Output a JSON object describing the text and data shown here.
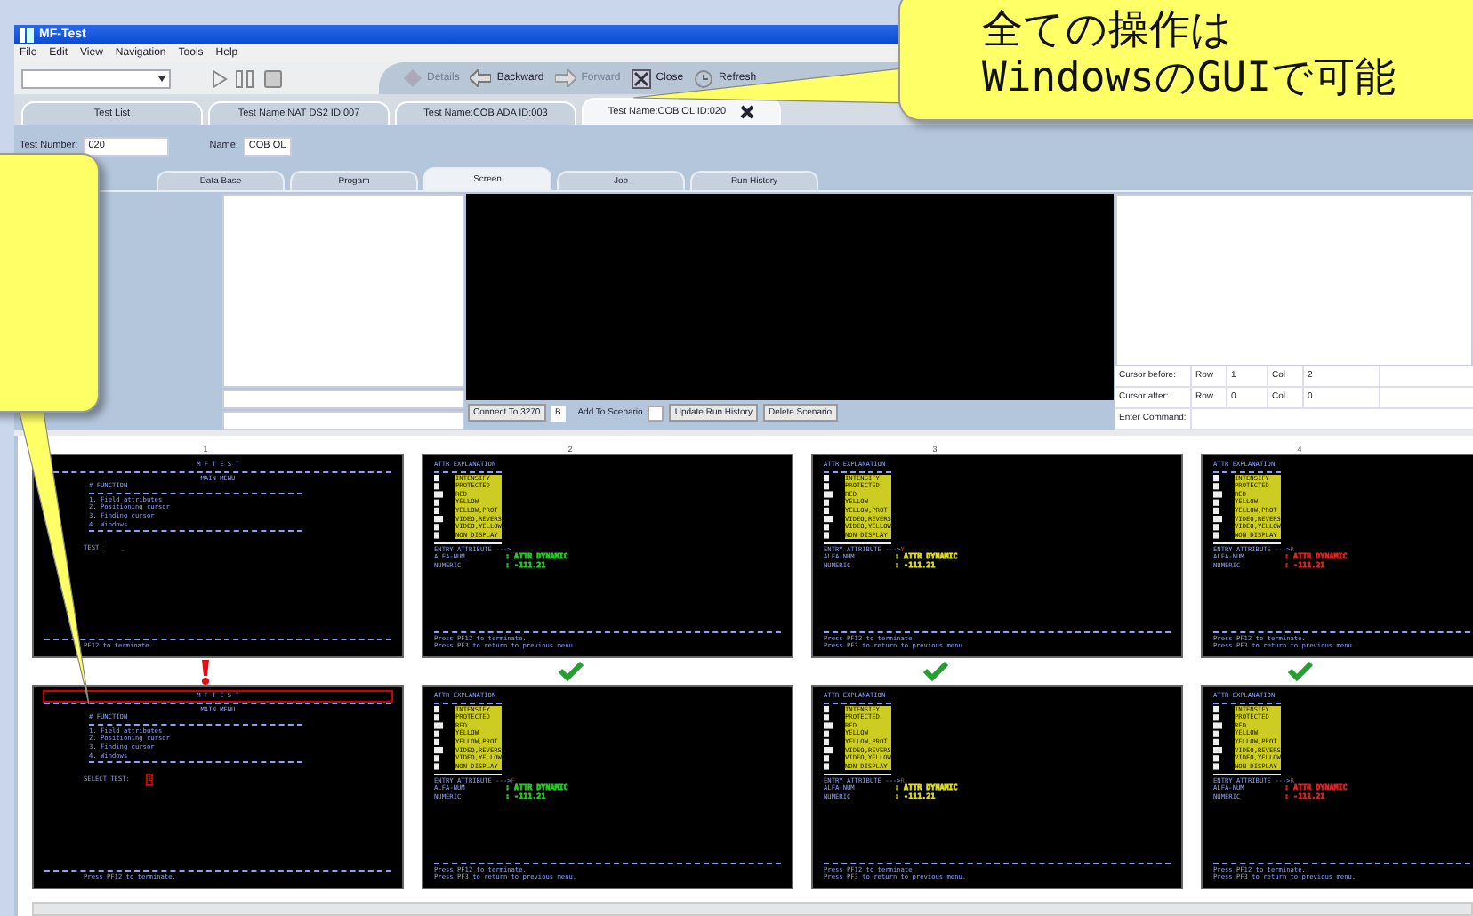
{
  "window": {
    "title": "MF-Test"
  },
  "menu": [
    "File",
    "Edit",
    "View",
    "Navigation",
    "Tools",
    "Help"
  ],
  "toolbar": [
    {
      "label": "Details",
      "kind": "details",
      "disabled": true
    },
    {
      "label": "Backward",
      "kind": "back",
      "disabled": false
    },
    {
      "label": "Forward",
      "kind": "forward",
      "disabled": true
    },
    {
      "label": "Close",
      "kind": "close",
      "disabled": false
    },
    {
      "label": "Refresh",
      "kind": "refresh",
      "disabled": false
    }
  ],
  "doc_tabs": [
    {
      "label": "Test List",
      "selected": false
    },
    {
      "label": "Test Name:NAT DS2  ID:007",
      "selected": false
    },
    {
      "label": "Test Name:COB ADA  ID:003",
      "selected": false
    },
    {
      "label": "Test Name:COB OL  ID:020",
      "selected": true
    }
  ],
  "form": {
    "number_label": "Test Number:",
    "number": "020",
    "name_label": "Name:",
    "name": "COB OL"
  },
  "inner_tabs": [
    {
      "label": "Data Base",
      "selected": false
    },
    {
      "label": "Progam",
      "selected": false
    },
    {
      "label": "Screen",
      "selected": true
    },
    {
      "label": "Job",
      "selected": false
    },
    {
      "label": "Run History",
      "selected": false
    }
  ],
  "screen_panel": {
    "connect": "Connect To 3270",
    "session": "B",
    "add_label": "Add To Scenario",
    "add_checked": false,
    "buttons": [
      "Update Run History",
      "Delete Scenario"
    ]
  },
  "cursor": {
    "rows": [
      {
        "label": "Cursor before:",
        "row_label": "Row",
        "row": "1",
        "col_label": "Col",
        "col": "2"
      },
      {
        "label": "Cursor after:",
        "row_label": "Row",
        "row": "0",
        "col_label": "Col",
        "col": "0"
      }
    ],
    "command_label": "Enter Command:"
  },
  "comparison": {
    "columns": [
      "1",
      "2",
      "3",
      "4"
    ],
    "rows": [
      {
        "screens": [
          {
            "kind": "menu",
            "title": "M F T E S T",
            "subtitle": "MAIN MENU",
            "header": "# FUNCTION",
            "items": [
              "1. Field attributes",
              "2. Positioning cursor",
              "3. Finding cursor",
              "4. Windows"
            ],
            "prompt": "TEST:",
            "entry": "_",
            "marked": false,
            "footer": [
              "PF12 to terminate."
            ]
          },
          {
            "kind": "attr",
            "title": "ATTR EXPLANATION",
            "attributes": [
              "INTENSIFY",
              "PROTECTED",
              "RED",
              "YELLOW",
              "YELLOW,PROT",
              "VIDEO,REVERS",
              "VIDEO,YELLOW",
              "NON DISPLAY"
            ],
            "entry_label": "ENTRY ATTRIBUTE --->",
            "entry": "_",
            "fields": [
              {
                "label": "ALFA-NUM",
                "value": ": ATTR DYNAMIC"
              },
              {
                "label": "NUMERIC",
                "value": ": -111.21"
              }
            ],
            "color": "#22cc22",
            "footer": [
              "Press PF12 to terminate.",
              "Press PF3 to return to previous menu."
            ]
          },
          {
            "kind": "attr",
            "title": "ATTR EXPLANATION",
            "attributes": [
              "INTENSIFY",
              "PROTECTED",
              "RED",
              "YELLOW",
              "YELLOW,PROT",
              "VIDEO,REVERS",
              "VIDEO,YELLOW",
              "NON DISPLAY"
            ],
            "entry_label": "ENTRY ATTRIBUTE --->",
            "entry": "Y",
            "fields": [
              {
                "label": "ALFA-NUM",
                "value": ": ATTR DYNAMIC"
              },
              {
                "label": "NUMERIC",
                "value": ": -111.21"
              }
            ],
            "color": "#dddd22",
            "footer": [
              "Press PF12 to terminate.",
              "Press PF3 to return to previous menu."
            ]
          },
          {
            "kind": "attr",
            "title": "ATTR EXPLANATION",
            "attributes": [
              "INTENSIFY",
              "PROTECTED",
              "RED",
              "YELLOW",
              "YELLOW,PROT",
              "VIDEO,REVERS",
              "VIDEO,YELLOW",
              "NON DISPLAY"
            ],
            "entry_label": "ENTRY ATTRIBUTE --->",
            "entry": "R",
            "fields": [
              {
                "label": "ALFA-NUM",
                "value": ": ATTR DYNAMIC"
              },
              {
                "label": "NUMERIC",
                "value": ": -111.21"
              }
            ],
            "color": "#dd2222",
            "footer": [
              "Press PF12 to terminate.",
              "Press PF3 to return to previous menu."
            ]
          }
        ]
      },
      {
        "screens": [
          {
            "kind": "menu",
            "title": "M F T E S T",
            "subtitle": "MAIN MENU",
            "header": "# FUNCTION",
            "items": [
              "1. Field attributes",
              "2. Positioning cursor",
              "3. Finding cursor",
              "4. Windows"
            ],
            "prompt": "SELECT TEST:",
            "entry": "1",
            "marked": true,
            "footer": [
              "Press PF12 to terminate."
            ]
          },
          {
            "kind": "attr",
            "title": "ATTR EXPLANATION",
            "attributes": [
              "INTENSIFY",
              "PROTECTED",
              "RED",
              "YELLOW",
              "YELLOW,PROT",
              "VIDEO,REVERS",
              "VIDEO,YELLOW",
              "NON DISPLAY"
            ],
            "entry_label": "ENTRY ATTRIBUTE --->",
            "entry": "F_",
            "fields": [
              {
                "label": "ALFA-NUM",
                "value": ": ATTR DYNAMIC"
              },
              {
                "label": "NUMERIC",
                "value": ": -111.21"
              }
            ],
            "color": "#22cc22",
            "footer": [
              "Press PF12 to terminate.",
              "Press PF3 to return to previous menu."
            ]
          },
          {
            "kind": "attr",
            "title": "ATTR EXPLANATION",
            "attributes": [
              "INTENSIFY",
              "PROTECTED",
              "RED",
              "YELLOW",
              "YELLOW,PROT",
              "VIDEO,REVERS",
              "VIDEO,YELLOW",
              "NON DISPLAY"
            ],
            "entry_label": "ENTRY ATTRIBUTE --->",
            "entry": "R",
            "fields": [
              {
                "label": "ALFA-NUM",
                "value": ": ATTR DYNAMIC"
              },
              {
                "label": "NUMERIC",
                "value": ": -111.21"
              }
            ],
            "color": "#dddd22",
            "footer": [
              "Press PF12 to terminate.",
              "Press PF3 to return to previous menu."
            ]
          },
          {
            "kind": "attr",
            "title": "ATTR EXPLANATION",
            "attributes": [
              "INTENSIFY",
              "PROTECTED",
              "RED",
              "YELLOW",
              "YELLOW,PROT",
              "VIDEO,REVERS",
              "VIDEO,YELLOW",
              "NON DISPLAY"
            ],
            "entry_label": "ENTRY ATTRIBUTE --->",
            "entry": "R",
            "fields": [
              {
                "label": "ALFA-NUM",
                "value": ": ATTR DYNAMIC"
              },
              {
                "label": "NUMERIC",
                "value": ": -111.21"
              }
            ],
            "color": "#dd2222",
            "footer": [
              "Press PF12 to terminate.",
              "Press PF3 to return to previous menu."
            ]
          }
        ]
      }
    ],
    "results": [
      {
        "match": false
      },
      {
        "match": true
      },
      {
        "match": true
      },
      {
        "match": true
      }
    ]
  },
  "callouts": [
    {
      "lines": [
        "全ての操作は",
        "WindowsのGUIで可能"
      ]
    }
  ]
}
